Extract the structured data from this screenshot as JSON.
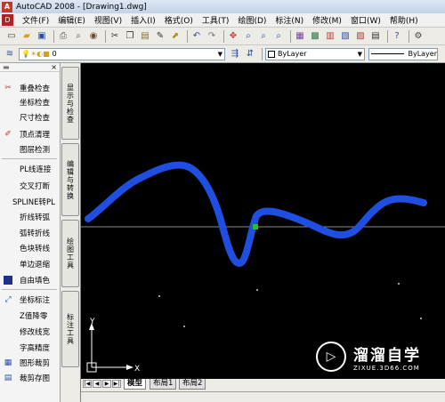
{
  "window": {
    "title": "AutoCAD 2008 - [Drawing1.dwg]"
  },
  "menu": [
    "文件(F)",
    "编辑(E)",
    "视图(V)",
    "插入(I)",
    "格式(O)",
    "工具(T)",
    "绘图(D)",
    "标注(N)",
    "修改(M)",
    "窗口(W)",
    "帮助(H)"
  ],
  "layer": {
    "current": "0"
  },
  "properties": {
    "color": "ByLayer",
    "linetype": "ByLayer"
  },
  "panel": {
    "close_glyph": "×"
  },
  "tools": [
    "重叠检查",
    "坐标检查",
    "尺寸检查",
    "顶点清理",
    "图层检测",
    "PL线连接",
    "交叉打断",
    "SPLINE转PL",
    "折线转弧",
    "弧转折线",
    "色块转线",
    "单边退缩",
    "自由填色",
    "坐标标注",
    "Z值降零",
    "修改线宽",
    "字高精度",
    "图形裁剪",
    "裁剪存图"
  ],
  "side_tabs": [
    "显示与检查",
    "编辑与转换",
    "绘图工具",
    "标注工具"
  ],
  "layout_tabs": [
    "模型",
    "布局1",
    "布局2"
  ],
  "ucs": {
    "y_label": "Y",
    "x_label": "X"
  },
  "watermark": {
    "name": "溜溜自学",
    "url": "ZIXUE.3D66.COM"
  },
  "colors": {
    "canvas": "#000000",
    "curve": "#1f4fe0",
    "highlight": "#22c322",
    "crosshair": "#8a8a8a"
  }
}
